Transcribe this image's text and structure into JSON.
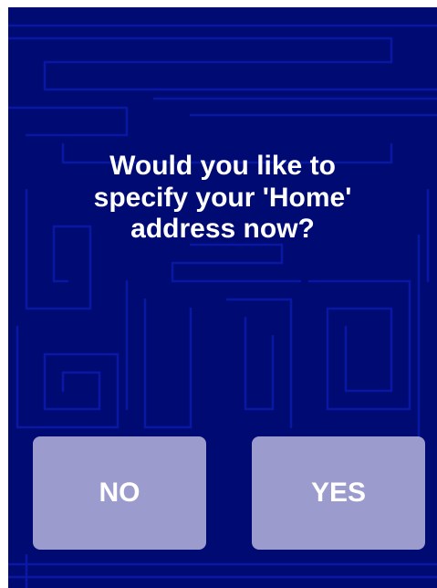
{
  "dialog": {
    "prompt_lines": [
      "Would you like to",
      "specify your 'Home'",
      "address now?"
    ]
  },
  "buttons": {
    "no_label": "NO",
    "yes_label": "YES"
  },
  "colors": {
    "background": "#000a73",
    "pattern": "#0b1aa8",
    "button": "#9b9bce",
    "text": "#ffffff"
  }
}
